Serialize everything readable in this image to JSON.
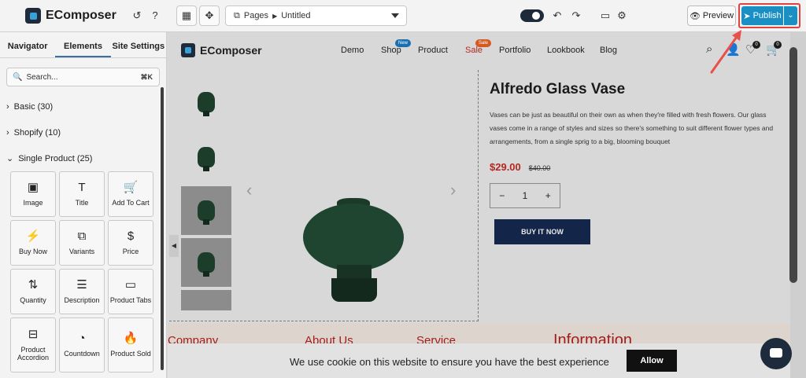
{
  "app": {
    "name": "EComposer",
    "page_select": {
      "prefix": "Pages",
      "value": "Untitled"
    },
    "preview_label": "Preview",
    "publish_label": "Publish"
  },
  "sidebar": {
    "tabs": [
      {
        "label": "Navigator"
      },
      {
        "label": "Elements"
      },
      {
        "label": "Site Settings"
      }
    ],
    "search": {
      "placeholder": "Search...",
      "shortcut": "⌘K"
    },
    "categories": [
      {
        "label": "Basic (30)"
      },
      {
        "label": "Shopify (10)"
      },
      {
        "label": "Single Product (25)"
      }
    ],
    "elements": [
      {
        "label": "Image",
        "icon": "▣"
      },
      {
        "label": "Title",
        "icon": "T"
      },
      {
        "label": "Add To Cart",
        "icon": "🛒"
      },
      {
        "label": "Buy Now",
        "icon": "⚡"
      },
      {
        "label": "Variants",
        "icon": "⧉"
      },
      {
        "label": "Price",
        "icon": "$"
      },
      {
        "label": "Quantity",
        "icon": "⇅"
      },
      {
        "label": "Description",
        "icon": "☰"
      },
      {
        "label": "Product Tabs",
        "icon": "▭"
      },
      {
        "label": "Product Accordion",
        "icon": "⊟"
      },
      {
        "label": "Countdown",
        "icon": "◔"
      },
      {
        "label": "Product Sold",
        "icon": "🔥"
      }
    ]
  },
  "store": {
    "logo": "EComposer",
    "nav": [
      {
        "label": "Demo"
      },
      {
        "label": "Shop",
        "badge": "New"
      },
      {
        "label": "Product"
      },
      {
        "label": "Sale",
        "badge": "Sale"
      },
      {
        "label": "Portfolio"
      },
      {
        "label": "Lookbook"
      },
      {
        "label": "Blog"
      }
    ],
    "wishlist_count": "0",
    "cart_count": "0",
    "product": {
      "title": "Alfredo Glass Vase",
      "description": "Vases can be just as beautiful on their own as when they're filled with fresh flowers. Our glass vases come in a range of styles and sizes so there's something to suit different flower types and arrangements, from a single sprig to a big, blooming bouquet",
      "price": "$29.00",
      "old_price": "$40.00",
      "quantity": "1",
      "buy_label": "BUY IT NOW"
    },
    "footer_headings": [
      {
        "label": "Company"
      },
      {
        "label": "About Us"
      },
      {
        "label": "Service"
      },
      {
        "label": "Information"
      }
    ],
    "cookie": {
      "text": "We use cookie on this website to ensure you have the best experience",
      "allow_label": "Allow"
    }
  },
  "colors": {
    "accent": "#1a8fc4",
    "sale": "#b3271f",
    "highlight": "#e0433f"
  }
}
